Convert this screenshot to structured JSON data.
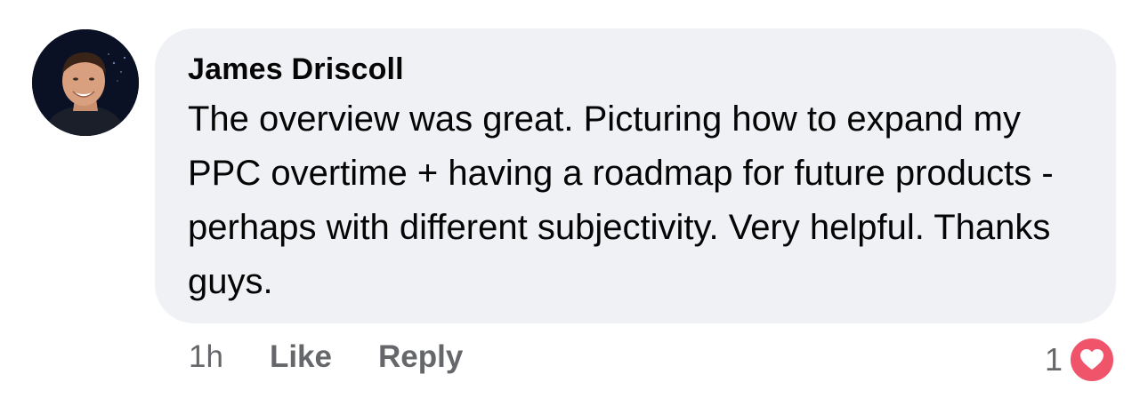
{
  "comment": {
    "author": "James Driscoll",
    "text": "The overview was great. Picturing how to expand my PPC overtime + having a roadmap for future products - perhaps with different subjectivity. Very helpful. Thanks guys.",
    "timestamp": "1h",
    "like_label": "Like",
    "reply_label": "Reply",
    "reaction_count": "1",
    "reaction_type": "love",
    "avatar_icon": "user-avatar-photo"
  },
  "colors": {
    "bubble_bg": "#f0f1f5",
    "meta_text": "#65676b",
    "reaction_love": "#f0546b"
  }
}
